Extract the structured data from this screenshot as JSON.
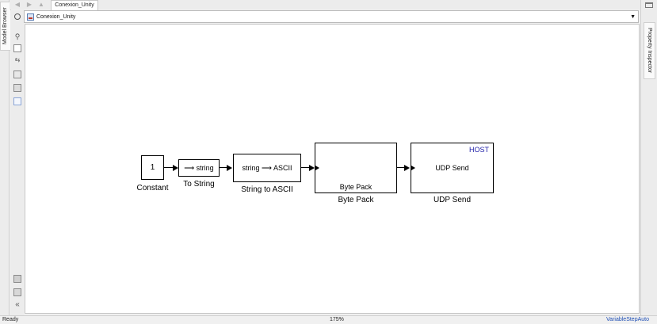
{
  "sidebar_left": {
    "label": "Model Browser"
  },
  "sidebar_right": {
    "label": "Property Inspector"
  },
  "tab": {
    "title": "Conexion_Unity"
  },
  "address_bar": {
    "path": "Conexion_Unity",
    "dropdown_icon": "chevron-down-icon"
  },
  "nav": {
    "back_icon": "arrow-left-icon",
    "forward_icon": "arrow-right-icon",
    "up_icon": "arrow-up-icon"
  },
  "toolbar": {
    "icons": [
      "zoom-icon",
      "fit-view-icon",
      "signal-arrows-icon",
      "image-icon",
      "image-alt-icon",
      "area-icon",
      "camera-icon",
      "library-icon",
      "collapse-left-icon"
    ]
  },
  "blocks": {
    "constant": {
      "value": "1",
      "label": "Constant"
    },
    "to_string": {
      "content": "⟶ string",
      "label": "To String"
    },
    "string_to_ascii": {
      "content": "string ⟶ ASCII",
      "label": "String to ASCII"
    },
    "byte_pack": {
      "content": "Byte Pack",
      "label": "Byte Pack"
    },
    "udp_send": {
      "content": "UDP Send",
      "host": "HOST",
      "label": "UDP Send"
    }
  },
  "colors": {
    "host_text": "#1a1aa6",
    "solver_text": "#1f4fb5"
  },
  "status_bar": {
    "state": "Ready",
    "zoom": "175%",
    "solver": "VariableStepAuto"
  }
}
